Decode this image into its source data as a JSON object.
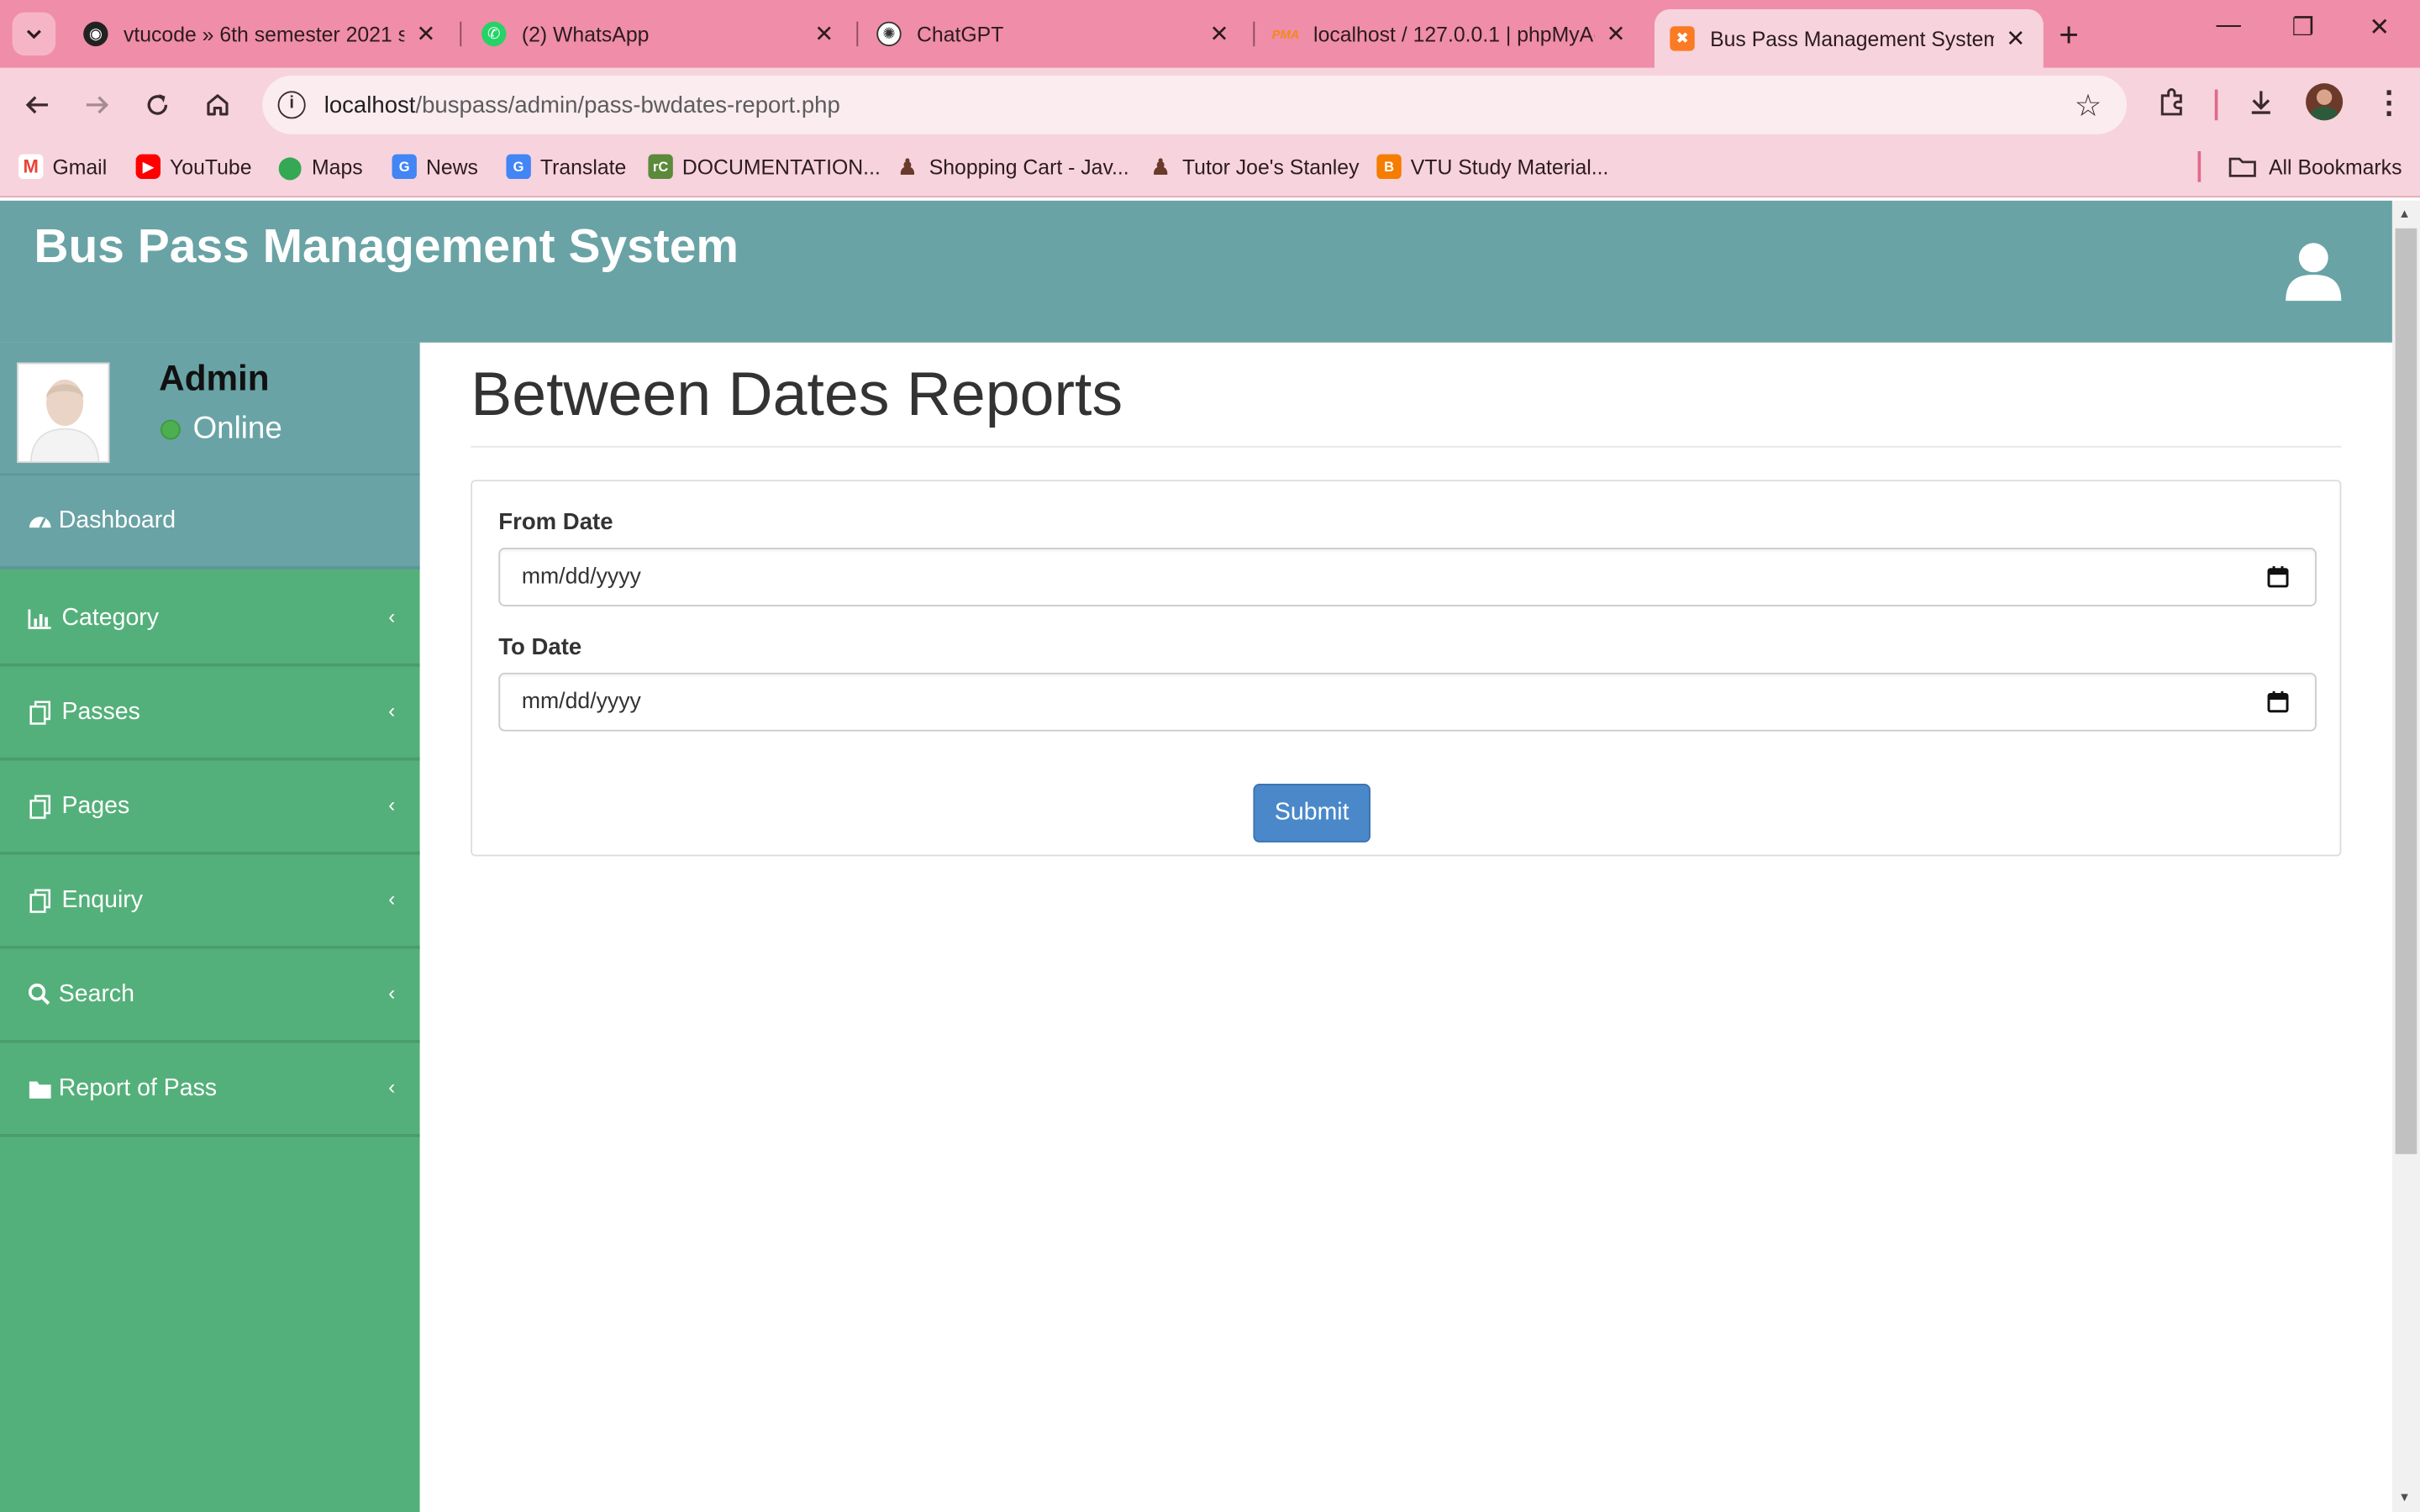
{
  "browser": {
    "tabs": [
      {
        "title": "vtucode » 6th semester 2021 sc",
        "icon": "vtucode-favicon",
        "active": false
      },
      {
        "title": "(2) WhatsApp",
        "icon": "whatsapp-favicon",
        "active": false
      },
      {
        "title": "ChatGPT",
        "icon": "chatgpt-favicon",
        "active": false
      },
      {
        "title": "localhost / 127.0.0.1 | phpMyAc",
        "icon": "phpmyadmin-favicon",
        "active": false
      },
      {
        "title": "Bus Pass Management System |",
        "icon": "xampp-favicon",
        "active": true
      }
    ],
    "url_host": "localhost",
    "url_path": "/buspass/admin/pass-bwdates-report.php",
    "bookmarks": [
      {
        "label": "Gmail",
        "icon": "gmail-icon"
      },
      {
        "label": "YouTube",
        "icon": "youtube-icon"
      },
      {
        "label": "Maps",
        "icon": "maps-icon"
      },
      {
        "label": "News",
        "icon": "news-icon"
      },
      {
        "label": "Translate",
        "icon": "translate-icon"
      },
      {
        "label": "DOCUMENTATION...",
        "icon": "documentation-icon"
      },
      {
        "label": "Shopping Cart - Jav...",
        "icon": "shopping-cart-icon"
      },
      {
        "label": "Tutor Joe's Stanley",
        "icon": "tutor-joes-icon"
      },
      {
        "label": "VTU Study Material...",
        "icon": "blogger-icon"
      }
    ],
    "all_bookmarks": "All Bookmarks"
  },
  "app": {
    "title": "Bus Pass Management System",
    "user": {
      "name": "Admin",
      "status": "Online"
    },
    "menu": [
      {
        "label": "Dashboard",
        "icon": "dashboard-icon"
      },
      {
        "label": "Category",
        "icon": "bar-chart-icon"
      },
      {
        "label": "Passes",
        "icon": "files-icon"
      },
      {
        "label": "Pages",
        "icon": "files-icon"
      },
      {
        "label": "Enquiry",
        "icon": "files-icon"
      },
      {
        "label": "Search",
        "icon": "search-icon"
      },
      {
        "label": "Report of Pass",
        "icon": "folder-icon"
      }
    ]
  },
  "main": {
    "page_title": "Between Dates Reports",
    "from_date": {
      "label": "From Date",
      "placeholder": "mm/dd/yyyy"
    },
    "to_date": {
      "label": "To Date",
      "placeholder": "mm/dd/yyyy"
    },
    "submit_label": "Submit"
  },
  "colors": {
    "browser_tab_bar": "#f08da8",
    "browser_toolbar": "#f7d3dd",
    "header_teal": "#69a3a5",
    "sidebar_green": "#54b07a",
    "submit_blue": "#4a88c9"
  }
}
